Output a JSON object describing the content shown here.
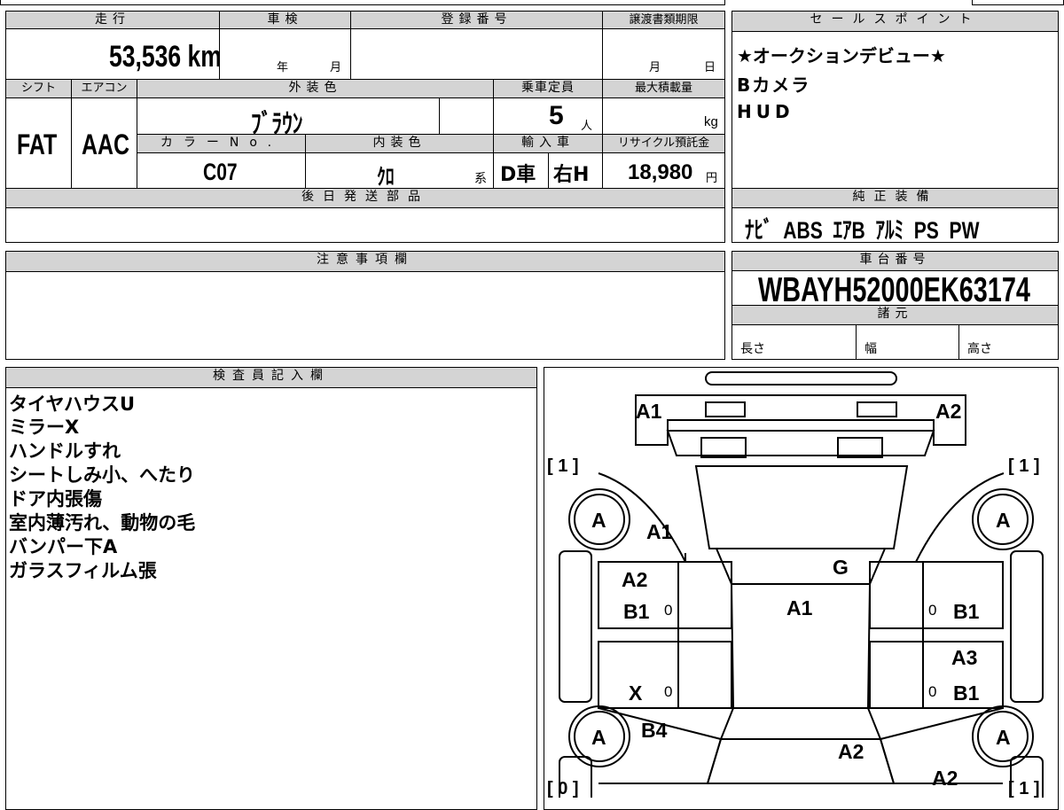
{
  "top_strip": {
    "text_a": "",
    "text_b": ""
  },
  "vehicle": {
    "mileage_label": "走行",
    "mileage": "53,536 km",
    "inspection_label": "車検",
    "inspection_year_unit": "年",
    "inspection_month_unit": "月",
    "registration_label": "登録番号",
    "registration_value": "",
    "transfer_deadline_label": "譲渡書類期限",
    "transfer_month_unit": "月",
    "transfer_day_unit": "日",
    "shift_label": "シフト",
    "shift": "FAT",
    "ac_label": "エアコン",
    "ac": "AAC",
    "exterior_color_label": "外装色",
    "exterior_color": "ﾌﾞﾗｳﾝ",
    "capacity_label": "乗車定員",
    "capacity": "5",
    "capacity_unit": "人",
    "max_load_label": "最大積載量",
    "max_load_unit": "kg",
    "color_no_label": "カラーNo.",
    "color_no": "C07",
    "interior_color_label": "内装色",
    "interior_color": "ｸﾛ",
    "interior_suffix": "系",
    "import_label": "輸入車",
    "import_type": "D車",
    "steering": "右H",
    "recycle_label": "リサイクル預託金",
    "recycle_fee": "18,980",
    "recycle_unit": "円",
    "later_parts_label": "後日発送部品"
  },
  "sales_points": {
    "label": "セールスポイント",
    "items": [
      "★オークションデビュー★",
      "Bカメラ",
      "HUD"
    ]
  },
  "equipment": {
    "label": "純正装備",
    "items": "ﾅﾋﾞ  ABS  ｴｱB  ｱﾙﾐ  PS  PW"
  },
  "notes": {
    "label": "注意事項欄"
  },
  "chassis": {
    "label": "車台番号",
    "number": "WBAYH52000EK63174",
    "spec_label": "諸元",
    "length_label": "長さ",
    "width_label": "幅",
    "height_label": "高さ"
  },
  "inspector": {
    "label": "検査員記入欄",
    "lines": [
      "タイヤハウスU",
      "ミラーX",
      "ハンドルすれ",
      "シートしみ小、へたり",
      "ドア内張傷",
      "室内薄汚れ、動物の毛",
      "バンパー下A",
      "ガラスフィルム張"
    ]
  },
  "diagram": {
    "front_left": "A1",
    "front_right": "A2",
    "hood": "A1",
    "windshield": "G",
    "roof": "A1",
    "left_front_door": [
      "A2",
      "B1"
    ],
    "left_rear_door": "X",
    "left_rear_fender": "B4",
    "right_front_door": "B1",
    "right_rear_door": [
      "A3",
      "B1"
    ],
    "trunk": "A2",
    "rear_right": "A2",
    "tire_fl": "A",
    "tire_fr": "A",
    "tire_rl": "A",
    "tire_rr": "A",
    "tread_fl": "[ 1 ]",
    "tread_fr": "[ 1 ]",
    "tread_rl": "[ 0 ]",
    "tread_rr": "[ 1 ]",
    "zero_marks": [
      "0",
      "0",
      "0",
      "0"
    ]
  }
}
